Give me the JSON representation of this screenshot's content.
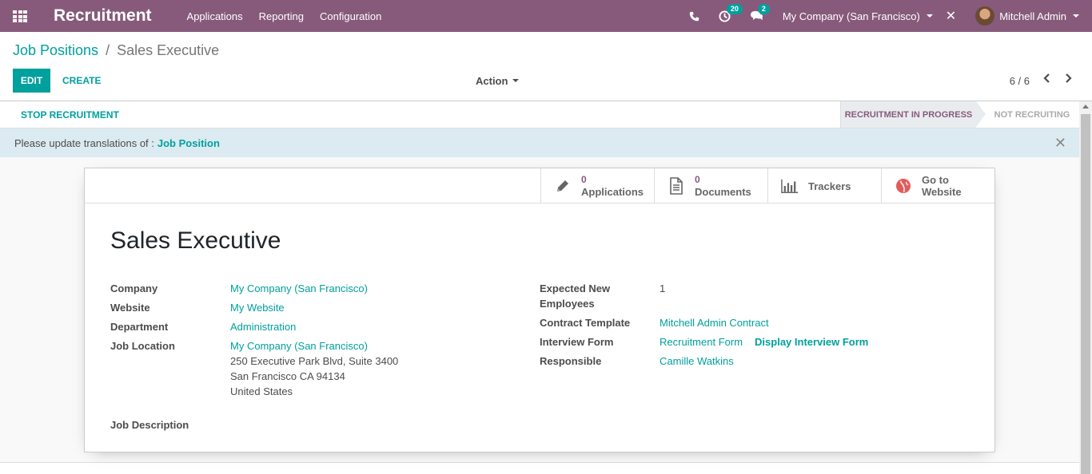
{
  "navbar": {
    "brand": "Recruitment",
    "menu": [
      "Applications",
      "Reporting",
      "Configuration"
    ],
    "activities_count": "20",
    "messages_count": "2",
    "company": "My Company (San Francisco)",
    "user": "Mitchell Admin"
  },
  "breadcrumb": {
    "parent": "Job Positions",
    "separator": "/",
    "current": "Sales Executive"
  },
  "toolbar": {
    "edit_label": "EDIT",
    "create_label": "CREATE",
    "action_label": "Action",
    "pager": "6 / 6"
  },
  "statusbar": {
    "stop_label": "STOP RECRUITMENT",
    "stage_active": "RECRUITMENT IN PROGRESS",
    "stage_inactive": "NOT RECRUITING"
  },
  "banner": {
    "text": "Please update translations of :",
    "link": "Job Position"
  },
  "stat_buttons": {
    "applications": {
      "value": "0",
      "label": "Applications"
    },
    "documents": {
      "value": "0",
      "label": "Documents"
    },
    "trackers": {
      "label": "Trackers"
    },
    "website": {
      "line1": "Go to",
      "line2": "Website"
    }
  },
  "record": {
    "title": "Sales Executive",
    "company_label": "Company",
    "company": "My Company (San Francisco)",
    "website_label": "Website",
    "website": "My Website",
    "department_label": "Department",
    "department": "Administration",
    "job_location_label": "Job Location",
    "job_location": "My Company (San Francisco)",
    "address_line1": "250 Executive Park Blvd, Suite 3400",
    "address_line2": "San Francisco CA 94134",
    "address_line3": "United States",
    "expected_label_1": "Expected New",
    "expected_label_2": "Employees",
    "expected": "1",
    "contract_label": "Contract Template",
    "contract": "Mitchell Admin Contract",
    "interview_label": "Interview Form",
    "interview": "Recruitment Form",
    "display_interview": "Display Interview Form",
    "responsible_label": "Responsible",
    "responsible": "Camille Watkins",
    "job_description_label": "Job Description"
  },
  "colors": {
    "brand": "#875a7b",
    "accent": "#00a09d",
    "banner": "#dbebf1"
  }
}
